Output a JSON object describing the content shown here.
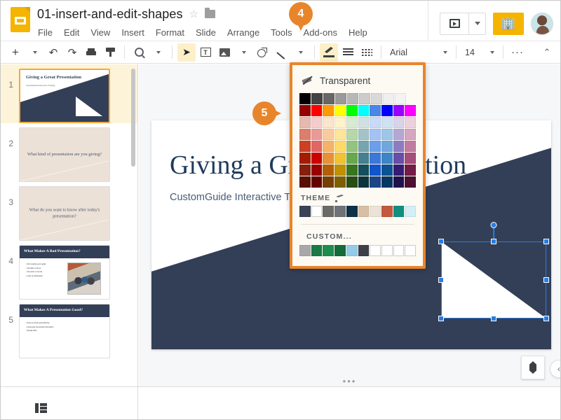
{
  "app": {
    "logo_icon": "slides-logo-icon",
    "doc_title": "01-insert-and-edit-shapes",
    "star_icon": "star-icon",
    "folder_icon": "folder-icon",
    "menu": [
      "File",
      "Edit",
      "View",
      "Insert",
      "Format",
      "Slide",
      "Arrange",
      "Tools",
      "Add-ons",
      "Help"
    ],
    "present_label": "present-icon",
    "share_label": "share-icon",
    "avatar_label": "user-avatar"
  },
  "toolbar": {
    "items": [
      {
        "name": "new-slide-button",
        "icon": "plus-icon"
      },
      {
        "name": "new-slide-dropdown",
        "icon": "chevron-down-icon"
      },
      {
        "name": "undo-button",
        "icon": "undo-icon"
      },
      {
        "name": "redo-button",
        "icon": "redo-icon"
      },
      {
        "name": "print-button",
        "icon": "print-icon"
      },
      {
        "name": "paint-format-button",
        "icon": "paint-format-icon"
      },
      {
        "name": "zoom-button",
        "icon": "zoom-icon"
      },
      {
        "name": "zoom-dropdown",
        "icon": "chevron-down-icon"
      },
      {
        "name": "select-tool-button",
        "icon": "cursor-icon"
      },
      {
        "name": "text-box-button",
        "icon": "text-box-icon"
      },
      {
        "name": "insert-image-button",
        "icon": "image-icon"
      },
      {
        "name": "insert-image-dropdown",
        "icon": "chevron-down-icon"
      },
      {
        "name": "shape-button",
        "icon": "shape-icon"
      },
      {
        "name": "line-button",
        "icon": "line-icon"
      },
      {
        "name": "line-dropdown",
        "icon": "chevron-down-icon"
      },
      {
        "name": "fill-color-button",
        "icon": "fill-color-icon"
      },
      {
        "name": "border-weight-button",
        "icon": "border-weight-icon"
      },
      {
        "name": "border-dash-button",
        "icon": "border-dash-icon"
      }
    ],
    "font_name": "Arial",
    "font_size": "14",
    "more_icon": "more-options-icon",
    "collapse_icon": "chevron-up-icon"
  },
  "filmstrip": {
    "slides": [
      {
        "number": "1",
        "type": "title",
        "title": "Giving a Great Presentation",
        "subtitle": "CustomGuide Interactive Training",
        "selected": true
      },
      {
        "number": "2",
        "type": "section",
        "text": "What kind of presentation are you giving?",
        "selected": false
      },
      {
        "number": "3",
        "type": "section",
        "text": "What do you want to know after today's presentation?",
        "selected": false
      },
      {
        "number": "4",
        "type": "content",
        "title": "What Makes A Bad Presentation?",
        "bullets": [
          "Not meeting your goals",
          "Too little or id too",
          "Too short or too far",
          "Lack of enthusiasm"
        ],
        "has_photo": true,
        "selected": false
      },
      {
        "number": "5",
        "type": "content",
        "title": "What Makes A Presentation Good?",
        "bullets": [
          "Know to know and authority",
          "Great and connected information",
          "Simple Plan"
        ],
        "has_photo": false,
        "selected": false
      }
    ]
  },
  "canvas": {
    "slide_title": "Giving a Great Presentation",
    "slide_subtitle": "CustomGuide Interactive Training",
    "selected_shape": "right-triangle-shape",
    "explore_icon": "explore-icon",
    "collapse_icon": "chevron-left-icon"
  },
  "color_picker": {
    "transparent_label": "Transparent",
    "transparent_icon": "transparent-icon",
    "theme_label": "THEME",
    "theme_pencil_icon": "pencil-icon",
    "custom_label": "CUSTOM...",
    "standard_rows": [
      [
        "#000000",
        "#434343",
        "#666666",
        "#999999",
        "#b7b7b7",
        "#cccccc",
        "#d9d9d9",
        "#efefef",
        "#f3f3f3"
      ],
      [
        "#980000",
        "#ff0000",
        "#ff9900",
        "#ffff00",
        "#00ff00",
        "#00ffff",
        "#4a86e8",
        "#0000ff",
        "#9900ff",
        "#ff00ff"
      ],
      [
        "#e6b8af",
        "#f4cccc",
        "#fce5cd",
        "#fff2cc",
        "#d9ead3",
        "#d0e0e3",
        "#c9daf8",
        "#cfe2f3",
        "#d9d2e9",
        "#ead1dc"
      ],
      [
        "#dd7e6b",
        "#ea9999",
        "#f9cb9c",
        "#ffe599",
        "#b6d7a8",
        "#a2c4c9",
        "#a4c2f4",
        "#9fc5e8",
        "#b4a7d6",
        "#d5a6bd"
      ],
      [
        "#cc4125",
        "#e06666",
        "#f6b26b",
        "#ffd966",
        "#93c47d",
        "#76a5af",
        "#6d9eeb",
        "#6fa8dc",
        "#8e7cc3",
        "#c27ba0"
      ],
      [
        "#a61c00",
        "#cc0000",
        "#e69138",
        "#f1c232",
        "#6aa84f",
        "#45818e",
        "#3c78d8",
        "#3d85c6",
        "#674ea7",
        "#a64d79"
      ],
      [
        "#85200c",
        "#990000",
        "#b45f06",
        "#bf9000",
        "#38761d",
        "#134f5c",
        "#1155cc",
        "#0b5394",
        "#351c75",
        "#741b47"
      ],
      [
        "#5b0f00",
        "#660000",
        "#783f04",
        "#7f6000",
        "#274e13",
        "#0c343d",
        "#1c4587",
        "#073763",
        "#20124d",
        "#4c1130"
      ]
    ],
    "theme_colors": [
      "#3a4256",
      "",
      "#6b6a66",
      "#6f7377",
      "#0f3147",
      "#d8bfa4",
      "#ece3d6",
      "#c4593f",
      "#0f8f80",
      "#d3eff5"
    ],
    "custom_colors": [
      "#a8a8a8",
      "#1a7a46",
      "#1f8c50",
      "#146b3a",
      "#93cbe8",
      "#3f3f4a",
      "",
      "",
      "",
      ""
    ]
  },
  "callouts": [
    {
      "number": "4",
      "name": "callout-badge-4"
    },
    {
      "number": "5",
      "name": "callout-badge-5"
    }
  ],
  "bottom_bar": {
    "filmstrip_view_icon": "filmstrip-view-icon",
    "grid_view_icon": "grid-view-icon"
  }
}
